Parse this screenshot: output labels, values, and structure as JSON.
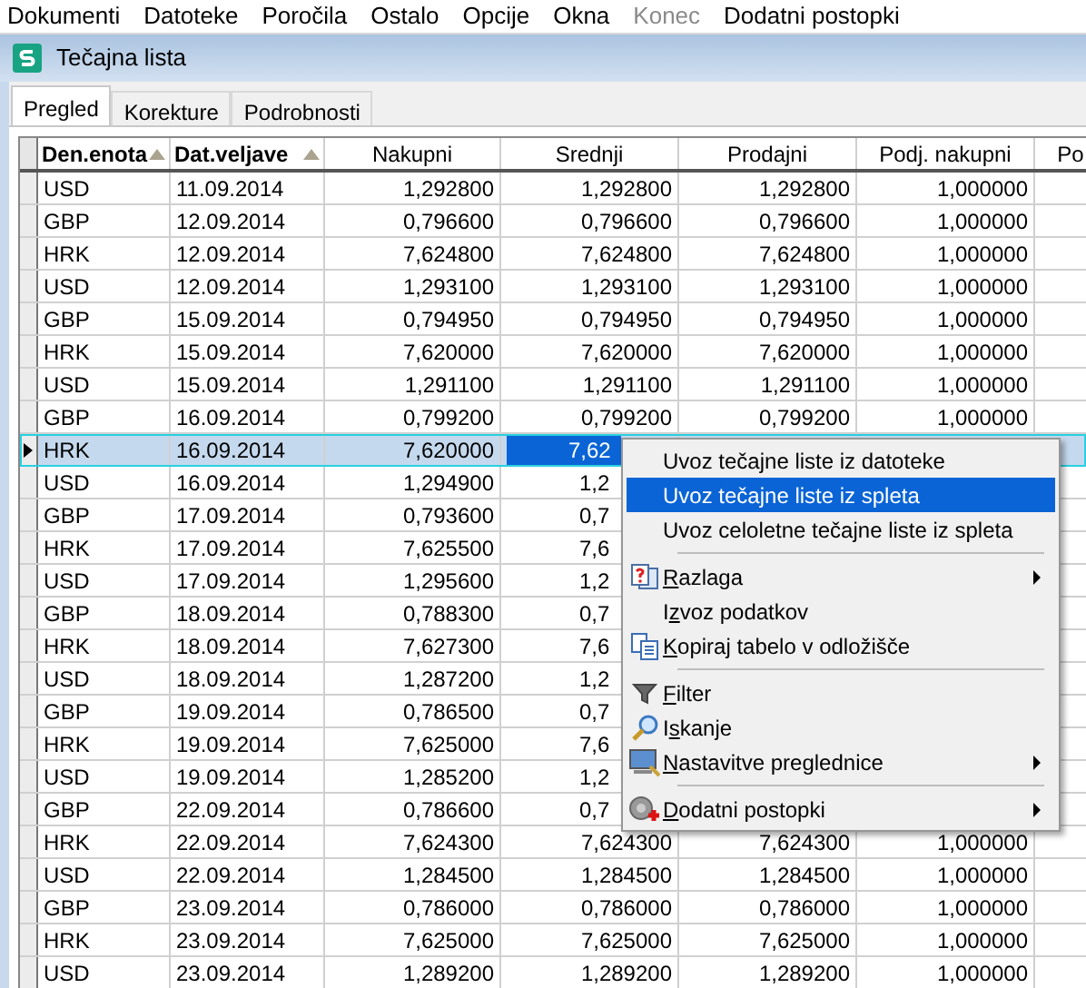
{
  "menu_bar": [
    {
      "label": "Dokumenti",
      "disabled": false
    },
    {
      "label": "Datoteke",
      "disabled": false
    },
    {
      "label": "Poročila",
      "disabled": false
    },
    {
      "label": "Ostalo",
      "disabled": false
    },
    {
      "label": "Opcije",
      "disabled": false
    },
    {
      "label": "Okna",
      "disabled": false
    },
    {
      "label": "Konec",
      "disabled": true
    },
    {
      "label": "Dodatni postopki",
      "disabled": false
    }
  ],
  "window": {
    "title": "Tečajna lista"
  },
  "tabs": [
    {
      "label": "Pregled",
      "selected": true
    },
    {
      "label": "Korekture",
      "selected": false
    },
    {
      "label": "Podrobnosti",
      "selected": false
    }
  ],
  "table": {
    "columns": [
      {
        "label": "Den.enota",
        "sorted": true
      },
      {
        "label": "Dat.veljave",
        "sorted": true
      },
      {
        "label": "Nakupni",
        "sorted": false
      },
      {
        "label": "Srednji",
        "sorted": false
      },
      {
        "label": "Prodajni",
        "sorted": false
      },
      {
        "label": "Podj. nakupni",
        "sorted": false
      },
      {
        "label": "Po",
        "sorted": false
      }
    ],
    "rows": [
      {
        "kind": "full",
        "selected": false,
        "cells": [
          "USD",
          "11.09.2014",
          "1,292800",
          "1,292800",
          "1,292800",
          "1,000000"
        ]
      },
      {
        "kind": "full",
        "selected": false,
        "cells": [
          "GBP",
          "12.09.2014",
          "0,796600",
          "0,796600",
          "0,796600",
          "1,000000"
        ]
      },
      {
        "kind": "full",
        "selected": false,
        "cells": [
          "HRK",
          "12.09.2014",
          "7,624800",
          "7,624800",
          "7,624800",
          "1,000000"
        ]
      },
      {
        "kind": "full",
        "selected": false,
        "cells": [
          "USD",
          "12.09.2014",
          "1,293100",
          "1,293100",
          "1,293100",
          "1,000000"
        ]
      },
      {
        "kind": "full",
        "selected": false,
        "cells": [
          "GBP",
          "15.09.2014",
          "0,794950",
          "0,794950",
          "0,794950",
          "1,000000"
        ]
      },
      {
        "kind": "full",
        "selected": false,
        "cells": [
          "HRK",
          "15.09.2014",
          "7,620000",
          "7,620000",
          "7,620000",
          "1,000000"
        ]
      },
      {
        "kind": "full",
        "selected": false,
        "cells": [
          "USD",
          "15.09.2014",
          "1,291100",
          "1,291100",
          "1,291100",
          "1,000000"
        ]
      },
      {
        "kind": "full",
        "selected": false,
        "cells": [
          "GBP",
          "16.09.2014",
          "0,799200",
          "0,799200",
          "0,799200",
          "1,000000"
        ]
      },
      {
        "kind": "covered",
        "selected": true,
        "cells": [
          "HRK",
          "16.09.2014",
          "7,620000",
          "7,62"
        ]
      },
      {
        "kind": "covered",
        "selected": false,
        "cells": [
          "USD",
          "16.09.2014",
          "1,294900",
          "1,2"
        ]
      },
      {
        "kind": "covered",
        "selected": false,
        "cells": [
          "GBP",
          "17.09.2014",
          "0,793600",
          "0,7"
        ]
      },
      {
        "kind": "covered",
        "selected": false,
        "cells": [
          "HRK",
          "17.09.2014",
          "7,625500",
          "7,6"
        ]
      },
      {
        "kind": "covered",
        "selected": false,
        "cells": [
          "USD",
          "17.09.2014",
          "1,295600",
          "1,2"
        ]
      },
      {
        "kind": "covered",
        "selected": false,
        "cells": [
          "GBP",
          "18.09.2014",
          "0,788300",
          "0,7"
        ]
      },
      {
        "kind": "covered",
        "selected": false,
        "cells": [
          "HRK",
          "18.09.2014",
          "7,627300",
          "7,6"
        ]
      },
      {
        "kind": "covered",
        "selected": false,
        "cells": [
          "USD",
          "18.09.2014",
          "1,287200",
          "1,2"
        ]
      },
      {
        "kind": "covered",
        "selected": false,
        "cells": [
          "GBP",
          "19.09.2014",
          "0,786500",
          "0,7"
        ]
      },
      {
        "kind": "covered",
        "selected": false,
        "cells": [
          "HRK",
          "19.09.2014",
          "7,625000",
          "7,6"
        ]
      },
      {
        "kind": "covered",
        "selected": false,
        "cells": [
          "USD",
          "19.09.2014",
          "1,285200",
          "1,2"
        ]
      },
      {
        "kind": "covered",
        "selected": false,
        "cells": [
          "GBP",
          "22.09.2014",
          "0,786600",
          "0,7"
        ]
      },
      {
        "kind": "full",
        "selected": false,
        "cells": [
          "HRK",
          "22.09.2014",
          "7,624300",
          "7,624300",
          "7,624300",
          "1,000000"
        ]
      },
      {
        "kind": "full",
        "selected": false,
        "cells": [
          "USD",
          "22.09.2014",
          "1,284500",
          "1,284500",
          "1,284500",
          "1,000000"
        ]
      },
      {
        "kind": "full",
        "selected": false,
        "cells": [
          "GBP",
          "23.09.2014",
          "0,786000",
          "0,786000",
          "0,786000",
          "1,000000"
        ]
      },
      {
        "kind": "full",
        "selected": false,
        "cells": [
          "HRK",
          "23.09.2014",
          "7,625000",
          "7,625000",
          "7,625000",
          "1,000000"
        ]
      },
      {
        "kind": "full",
        "selected": false,
        "cells": [
          "USD",
          "23.09.2014",
          "1,289200",
          "1,289200",
          "1,289200",
          "1,000000"
        ]
      }
    ]
  },
  "context_menu": [
    {
      "kind": "plain",
      "post": "Uvoz tečajne liste iz datoteke",
      "selected": false,
      "submenu": false
    },
    {
      "kind": "plain",
      "post": "Uvoz tečajne liste iz spleta",
      "selected": true,
      "submenu": false
    },
    {
      "kind": "plain",
      "post": "Uvoz celoletne tečajne liste iz spleta",
      "selected": false,
      "submenu": false
    },
    {
      "kind": "separator"
    },
    {
      "kind": "explain",
      "accel": "R",
      "post": "azlaga",
      "selected": false,
      "submenu": true
    },
    {
      "kind": "plain",
      "pre": "I",
      "accel": "z",
      "post": "voz podatkov",
      "selected": false,
      "submenu": false
    },
    {
      "kind": "copy",
      "accel": "K",
      "post": "opiraj tabelo v odložišče",
      "selected": false,
      "submenu": false
    },
    {
      "kind": "separator"
    },
    {
      "kind": "filter",
      "accel": "F",
      "post": "ilter",
      "selected": false,
      "submenu": false
    },
    {
      "kind": "search",
      "pre": "I",
      "accel": "s",
      "post": "kanje",
      "selected": false,
      "submenu": false
    },
    {
      "kind": "settings",
      "accel": "N",
      "post": "astavitve preglednice",
      "selected": false,
      "submenu": true
    },
    {
      "kind": "separator"
    },
    {
      "kind": "tools",
      "accel": "D",
      "post": "odatni postopki",
      "selected": false,
      "submenu": true
    }
  ]
}
